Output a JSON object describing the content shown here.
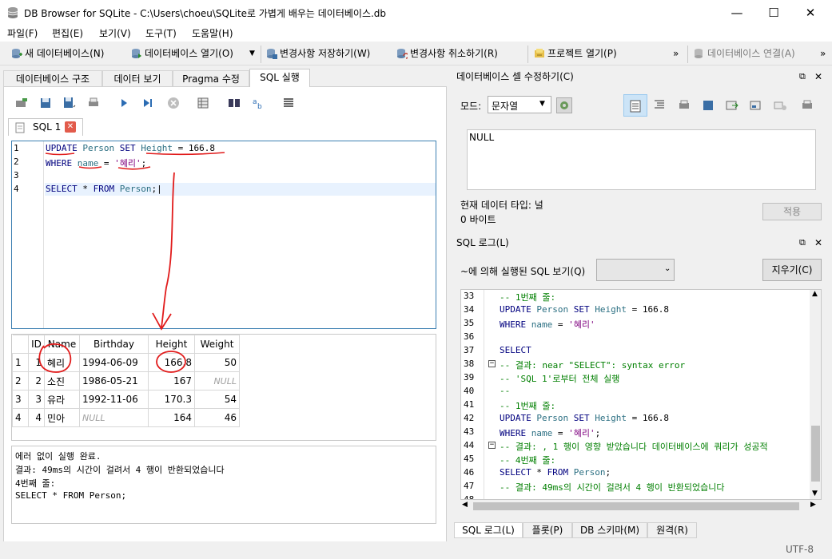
{
  "window": {
    "title": "DB Browser for SQLite - C:\\Users\\choeu\\SQLite로 가볍게 배우는 데이터베이스.db",
    "minimize": "—",
    "maximize": "☐",
    "close": "✕"
  },
  "menu": [
    "파일(F)",
    "편집(E)",
    "보기(V)",
    "도구(T)",
    "도움말(H)"
  ],
  "toolbar": {
    "new_db": "새 데이터베이스(N)",
    "open_db": "데이터베이스 열기(O)",
    "write_changes": "변경사항 저장하기(W)",
    "revert_changes": "변경사항 취소하기(R)",
    "open_project": "프로젝트 열기(P)",
    "more": "»",
    "connect_db": "데이터베이스 연결(A)",
    "more2": "»"
  },
  "tabs": [
    "데이터베이스 구조",
    "데이터 보기",
    "Pragma 수정",
    "SQL 실행"
  ],
  "sql_tab": {
    "label": "SQL 1",
    "close": "✕"
  },
  "editor": {
    "line_numbers": [
      "1",
      "2",
      "3",
      "4"
    ],
    "line1": {
      "kw1": "UPDATE",
      "table": "Person",
      "kw2": "SET",
      "col": "Height",
      "rest": " = 166.8"
    },
    "line2": {
      "kw": "WHERE",
      "col": "name",
      "eq": " = ",
      "str": "'혜리'",
      "end": ";"
    },
    "line4": {
      "kw1": "SELECT",
      "star": " * ",
      "kw2": "FROM",
      "table": "Person",
      "end": ";"
    }
  },
  "results": {
    "columns": [
      "ID",
      "Name",
      "Birthday",
      "Height",
      "Weight"
    ],
    "rows": [
      {
        "rownum": "1",
        "id": "1",
        "name": "혜리",
        "birthday": "1994-06-09",
        "height": "166.8",
        "weight": "50"
      },
      {
        "rownum": "2",
        "id": "2",
        "name": "소진",
        "birthday": "1986-05-21",
        "height": "167",
        "weight": "NULL"
      },
      {
        "rownum": "3",
        "id": "3",
        "name": "유라",
        "birthday": "1992-11-06",
        "height": "170.3",
        "weight": "54"
      },
      {
        "rownum": "4",
        "id": "4",
        "name": "민아",
        "birthday": "NULL",
        "height": "164",
        "weight": "46"
      }
    ]
  },
  "messages": [
    "에러 없이 실행 완료.",
    "결과: 49ms의 시간이 걸려서 4 행이 반환되었습니다",
    "4번째 줄:",
    "SELECT * FROM Person;"
  ],
  "cell_editor": {
    "header": "데이터베이스 셀 수정하기(C)",
    "mode_label": "모드:",
    "mode_value": "문자열",
    "value": "NULL",
    "type_label": "현재 데이터 타입: 널",
    "size_label": "0 바이트",
    "apply": "적용"
  },
  "sql_log": {
    "header": "SQL 로그(L)",
    "filter_label": "~에 의해 실행된 SQL 보기(Q)",
    "clear": "지우기(C)",
    "lines": [
      {
        "n": "33",
        "kind": "cmt",
        "text": "-- 1번째 줄:"
      },
      {
        "n": "34",
        "kind": "sql1",
        "text": "UPDATE Person SET Height = 166.8"
      },
      {
        "n": "35",
        "kind": "sql2",
        "text": "WHERE name = '혜리'"
      },
      {
        "n": "36",
        "kind": "blank",
        "text": ""
      },
      {
        "n": "37",
        "kind": "sql3",
        "text": "SELECT"
      },
      {
        "n": "38",
        "kind": "cmt",
        "text": "-- 결과: near \"SELECT\": syntax error"
      },
      {
        "n": "39",
        "kind": "cmt",
        "text": "-- 'SQL 1'로부터 전체 실행"
      },
      {
        "n": "40",
        "kind": "cmt",
        "text": "--"
      },
      {
        "n": "41",
        "kind": "cmt",
        "text": "-- 1번째 줄:"
      },
      {
        "n": "42",
        "kind": "sql1",
        "text": "UPDATE Person SET Height = 166.8"
      },
      {
        "n": "43",
        "kind": "sql2b",
        "text": "WHERE name = '혜리';"
      },
      {
        "n": "44",
        "kind": "cmt",
        "text": "-- 결과: , 1 행이 영향 받았습니다 데이터베이스에 쿼리가 성공적"
      },
      {
        "n": "45",
        "kind": "cmt",
        "text": "-- 4번째 줄:"
      },
      {
        "n": "46",
        "kind": "sql4",
        "text": "SELECT * FROM Person;"
      },
      {
        "n": "47",
        "kind": "cmt",
        "text": "-- 결과: 49ms의 시간이 걸려서 4 행이 반환되었습니다"
      },
      {
        "n": "48",
        "kind": "blank",
        "text": ""
      }
    ]
  },
  "bottom_tabs": [
    "SQL 로그(L)",
    "플롯(P)",
    "DB 스키마(M)",
    "원격(R)"
  ],
  "status": {
    "encoding": "UTF-8"
  },
  "colors": {
    "annotation": "#e11b1b",
    "keyword": "#00007f",
    "identifier": "#2b6f82",
    "string": "#7f007f",
    "comment": "#007f00"
  }
}
